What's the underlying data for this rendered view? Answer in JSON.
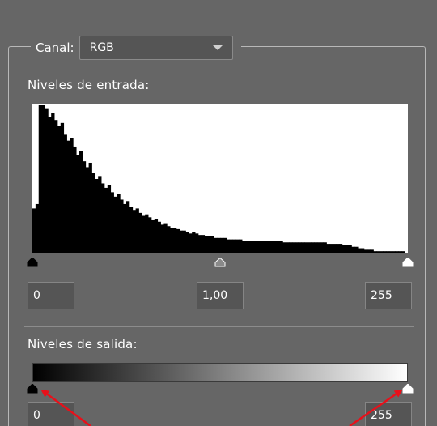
{
  "channel": {
    "label": "Canal:",
    "selected": "RGB"
  },
  "input_levels": {
    "label": "Niveles de entrada:",
    "black_value": "0",
    "gamma_value": "1,00",
    "white_value": "255",
    "black_point": 0,
    "gamma_position": 0.5,
    "white_point": 255
  },
  "output_levels": {
    "label": "Niveles de salida:",
    "black_value": "0",
    "white_value": "255",
    "black_point": 0,
    "white_point": 255
  },
  "histogram": {
    "bins": [
      30,
      33,
      100,
      100,
      98,
      92,
      95,
      90,
      86,
      88,
      80,
      76,
      78,
      72,
      66,
      69,
      62,
      58,
      61,
      54,
      50,
      52,
      47,
      44,
      46,
      41,
      38,
      40,
      36,
      33,
      35,
      31,
      29,
      30,
      27,
      25,
      26,
      24,
      22,
      23,
      21,
      19,
      20,
      18,
      17,
      17,
      16,
      15,
      15,
      14,
      13,
      14,
      13,
      12,
      12,
      11,
      11,
      11,
      10,
      10,
      10,
      10,
      9,
      9,
      9,
      9,
      9,
      8,
      8,
      8,
      8,
      8,
      8,
      8,
      8,
      8,
      8,
      8,
      8,
      8,
      7,
      7,
      7,
      7,
      7,
      7,
      7,
      7,
      7,
      7,
      7,
      7,
      7,
      7,
      6,
      6,
      6,
      6,
      6,
      5,
      5,
      5,
      4,
      4,
      3,
      3,
      2,
      2,
      2,
      1,
      1,
      1,
      1,
      1,
      1,
      1,
      1,
      1,
      1,
      0
    ]
  }
}
